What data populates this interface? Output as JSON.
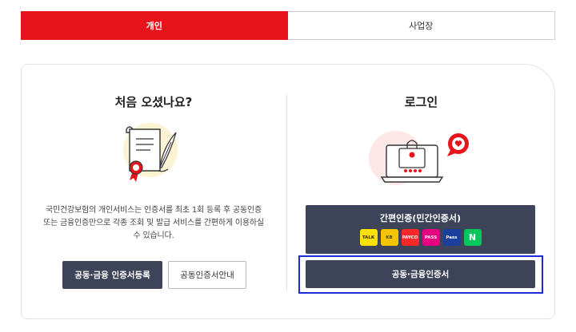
{
  "tabs": [
    {
      "label": "개인",
      "active": true
    },
    {
      "label": "사업장",
      "active": false
    }
  ],
  "left": {
    "heading": "처음 오셨나요?",
    "description": "국민건강보험의 개인서비스는 인증서를 최초 1회 등록 후 공동인증 또는 금융인증만으로 각종 조회 및 발급 서비스를 간편하게 이용하실 수 있습니다.",
    "register_button": "공동·금융 인증서등록",
    "guide_button": "공동인증서안내"
  },
  "right": {
    "heading": "로그인",
    "simple_auth_label": "간편인증(민간인증서)",
    "providers": [
      {
        "name": "TALK",
        "bg": "#fae100",
        "fg": "#3a1d1d"
      },
      {
        "name": "KB",
        "bg": "#f5c400",
        "fg": "#4a3b2a"
      },
      {
        "name": "PAYCO",
        "bg": "#fa2828",
        "fg": "#ffffff"
      },
      {
        "name": "PASS",
        "bg": "#e4007f",
        "fg": "#ffffff"
      },
      {
        "name": "Pass",
        "bg": "#1a3f9c",
        "fg": "#ffffff"
      },
      {
        "name": "N",
        "bg": "#03c75a",
        "fg": "#ffffff"
      }
    ],
    "cert_button": "공동·금융인증서"
  },
  "colors": {
    "accent": "#e8141c",
    "dark_button": "#3d4459",
    "focus_outline": "#1d2bd8"
  },
  "icons": [
    "certificate-scroll-icon",
    "ribbon-seal-icon",
    "quill-pen-icon",
    "laptop-lock-icon",
    "heart-chat-bubble-icon"
  ]
}
